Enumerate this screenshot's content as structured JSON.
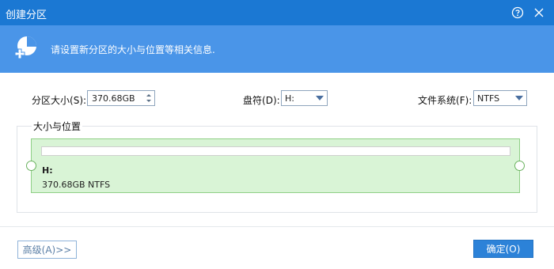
{
  "window": {
    "title": "创建分区"
  },
  "banner": {
    "message": "请设置新分区的大小与位置等相关信息."
  },
  "fields": {
    "size_label": "分区大小",
    "size_hotkey": "(S):",
    "size_value": "370.68GB",
    "drive_label": "盘符",
    "drive_hotkey": "(D):",
    "drive_value": "H:",
    "fs_label": "文件系统",
    "fs_hotkey": "(F):",
    "fs_value": "NTFS"
  },
  "group": {
    "title": "大小与位置",
    "partition_letter": "H:",
    "partition_info": "370.68GB NTFS"
  },
  "buttons": {
    "advanced": "高级(A)>>",
    "ok": "确定(O)"
  },
  "icons": {
    "help": "help-icon",
    "close": "close-icon",
    "logo": "partition-add-icon"
  },
  "colors": {
    "titlebar": "#1b78d3",
    "banner": "#4a95e8",
    "partition_fill": "#d9f4d6",
    "ok_button": "#2c82d8"
  }
}
